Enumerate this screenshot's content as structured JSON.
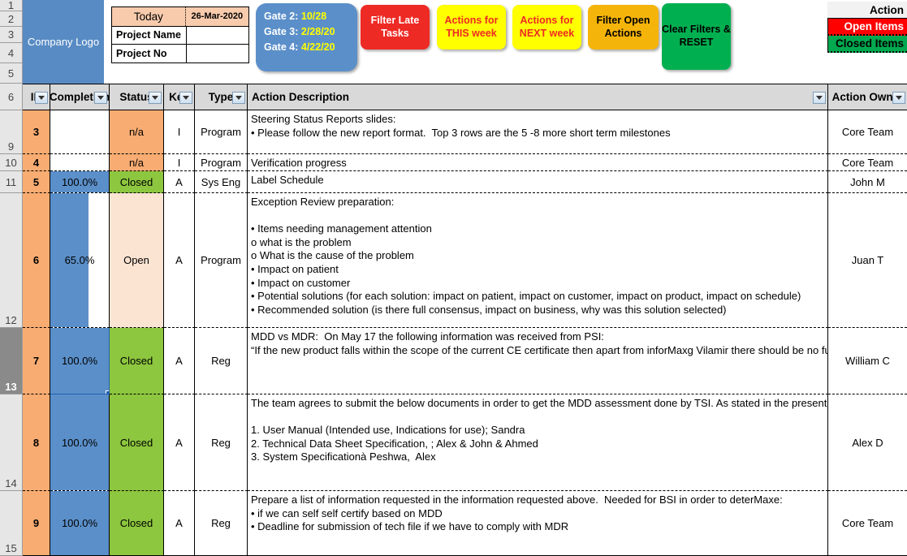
{
  "header": {
    "logo_text": "Company Logo",
    "info": {
      "today_label": "Today",
      "today_value": "26-Mar-2020",
      "project_name_label": "Project Name",
      "project_name_value": "",
      "project_no_label": "Project No",
      "project_no_value": ""
    },
    "gates": [
      {
        "label": "Gate 2:",
        "value": "10/28"
      },
      {
        "label": "Gate 3:",
        "value": "2/28/20"
      },
      {
        "label": "Gate 4:",
        "value": "4/22/20"
      }
    ],
    "buttons": [
      {
        "name": "filter-late-tasks",
        "label": "Filter Late Tasks",
        "bg": "#ee2a24",
        "fg": "#ffffff"
      },
      {
        "name": "actions-this-week",
        "label": "Actions for THIS week",
        "bg": "#ffff00",
        "fg": "#ee2a24"
      },
      {
        "name": "actions-next-week",
        "label": "Actions for NEXT week",
        "bg": "#ffff00",
        "fg": "#ee2a24"
      },
      {
        "name": "filter-open-actions",
        "label": "Filter Open Actions",
        "bg": "#f5b40a",
        "fg": "#000000"
      },
      {
        "name": "clear-filters-reset",
        "label": "Clear Filters & RESET",
        "bg": "#00b050",
        "fg": "#000000"
      }
    ],
    "legend": {
      "title": "Action",
      "open_label": "Open Items",
      "open_color": "#ff0000",
      "closed_label": "Closed Items",
      "closed_color": "#00a94f"
    }
  },
  "grid": {
    "row_numbers": [
      "1",
      "2",
      "3",
      "4",
      "5",
      "6",
      "9",
      "10",
      "11",
      "12",
      "13",
      "14",
      "15"
    ],
    "selected_row_number": "13",
    "columns": [
      {
        "key": "id",
        "label": "ID",
        "filter": true
      },
      {
        "key": "completion",
        "label": "Completion",
        "filter": true
      },
      {
        "key": "status",
        "label": "Status",
        "filter": true
      },
      {
        "key": "key",
        "label": "Key",
        "filter": true
      },
      {
        "key": "type",
        "label": "Type",
        "filter": true
      },
      {
        "key": "description",
        "label": "Action Description",
        "filter": true
      },
      {
        "key": "owner",
        "label": "Action Owner",
        "filter": true
      }
    ],
    "rows": [
      {
        "row_number": "9",
        "id": "3",
        "completion": "",
        "completion_pct": 0,
        "status": "n/a",
        "status_style": "na",
        "key": "I",
        "type": "Program",
        "description": "Steering Status Reports slides:\n• Please follow the new report format.  Top 3 rows are the 5 -8 more short term milestones",
        "owner": "Core Team"
      },
      {
        "row_number": "10",
        "id": "4",
        "completion": "",
        "completion_pct": 0,
        "status": "n/a",
        "status_style": "na",
        "key": "I",
        "type": "Program",
        "description": "Verification progress",
        "owner": "Core Team"
      },
      {
        "row_number": "11",
        "id": "5",
        "completion": "100.0%",
        "completion_pct": 100,
        "status": "Closed",
        "status_style": "closed",
        "key": "A",
        "type": "Sys Eng",
        "description": "Label Schedule",
        "owner": "John M"
      },
      {
        "row_number": "12",
        "id": "6",
        "completion": "65.0%",
        "completion_pct": 65,
        "status": "Open",
        "status_style": "open",
        "key": "A",
        "type": "Program",
        "description": "Exception Review preparation:\n\n• Items needing management attention\no what is the problem\no What is the cause of the problem\n• Impact on patient\n• Impact on customer\n• Potential solutions (for each solution: impact on patient, impact on customer, impact on product, impact on schedule)\n• Recommended solution (is there full consensus, impact on business, why was this solution selected)",
        "owner": "Juan T"
      },
      {
        "row_number": "13",
        "id": "7",
        "completion": "100.0%",
        "completion_pct": 100,
        "status": "Closed",
        "status_style": "closed",
        "key": "A",
        "type": "Reg",
        "description": "MDD vs MDR:  On May 17 the following information was received from PSI:\n“If the new product falls within the scope of the current CE certificate then apart from inforMaxg Vilamir there should be no further review required for the class IIa and IIb products.  However, he would need to check that there is no new technology or indications that would take it outside the certificate scope and warrant some review.  I assume this is unlikely but just letting you know to keep Luca up to date.",
        "owner": "William C"
      },
      {
        "row_number": "14",
        "id": "8",
        "completion": "100.0%",
        "completion_pct": 100,
        "status": "Closed",
        "status_style": "closed",
        "key": "A",
        "type": "Reg",
        "description": "The team agrees to submit the below documents in order to get the MDD assessment done by TSI. As stated in the presentation, the latest date to submit is Sep, however we need to submit these documents asap (target in next week – the week start with 6/17) to mitigate the risks;\n\n1. User Manual (Intended use, Indications for use); Sandra\n2. Technical Data Sheet Specification, ; Alex & John & Ahmed\n3. System Specificationà Peshwa,  Alex",
        "owner": "Alex D"
      },
      {
        "row_number": "15",
        "id": "9",
        "completion": "100.0%",
        "completion_pct": 100,
        "status": "Closed",
        "status_style": "closed",
        "key": "A",
        "type": "Reg",
        "description": "Prepare a list of information requested in the information requested above.  Needed for BSI in order to deterMaxe:\n• if we can self self certify based on MDD\n• Deadline for submission of tech file if we have to comply with MDR",
        "owner": "Core Team"
      }
    ]
  },
  "colors": {
    "accent_blue": "#5b8fc9",
    "id_orange": "#f8ac72",
    "status_green": "#8dc63f",
    "status_open": "#fce4d3",
    "header_gray": "#d9d9d9"
  }
}
